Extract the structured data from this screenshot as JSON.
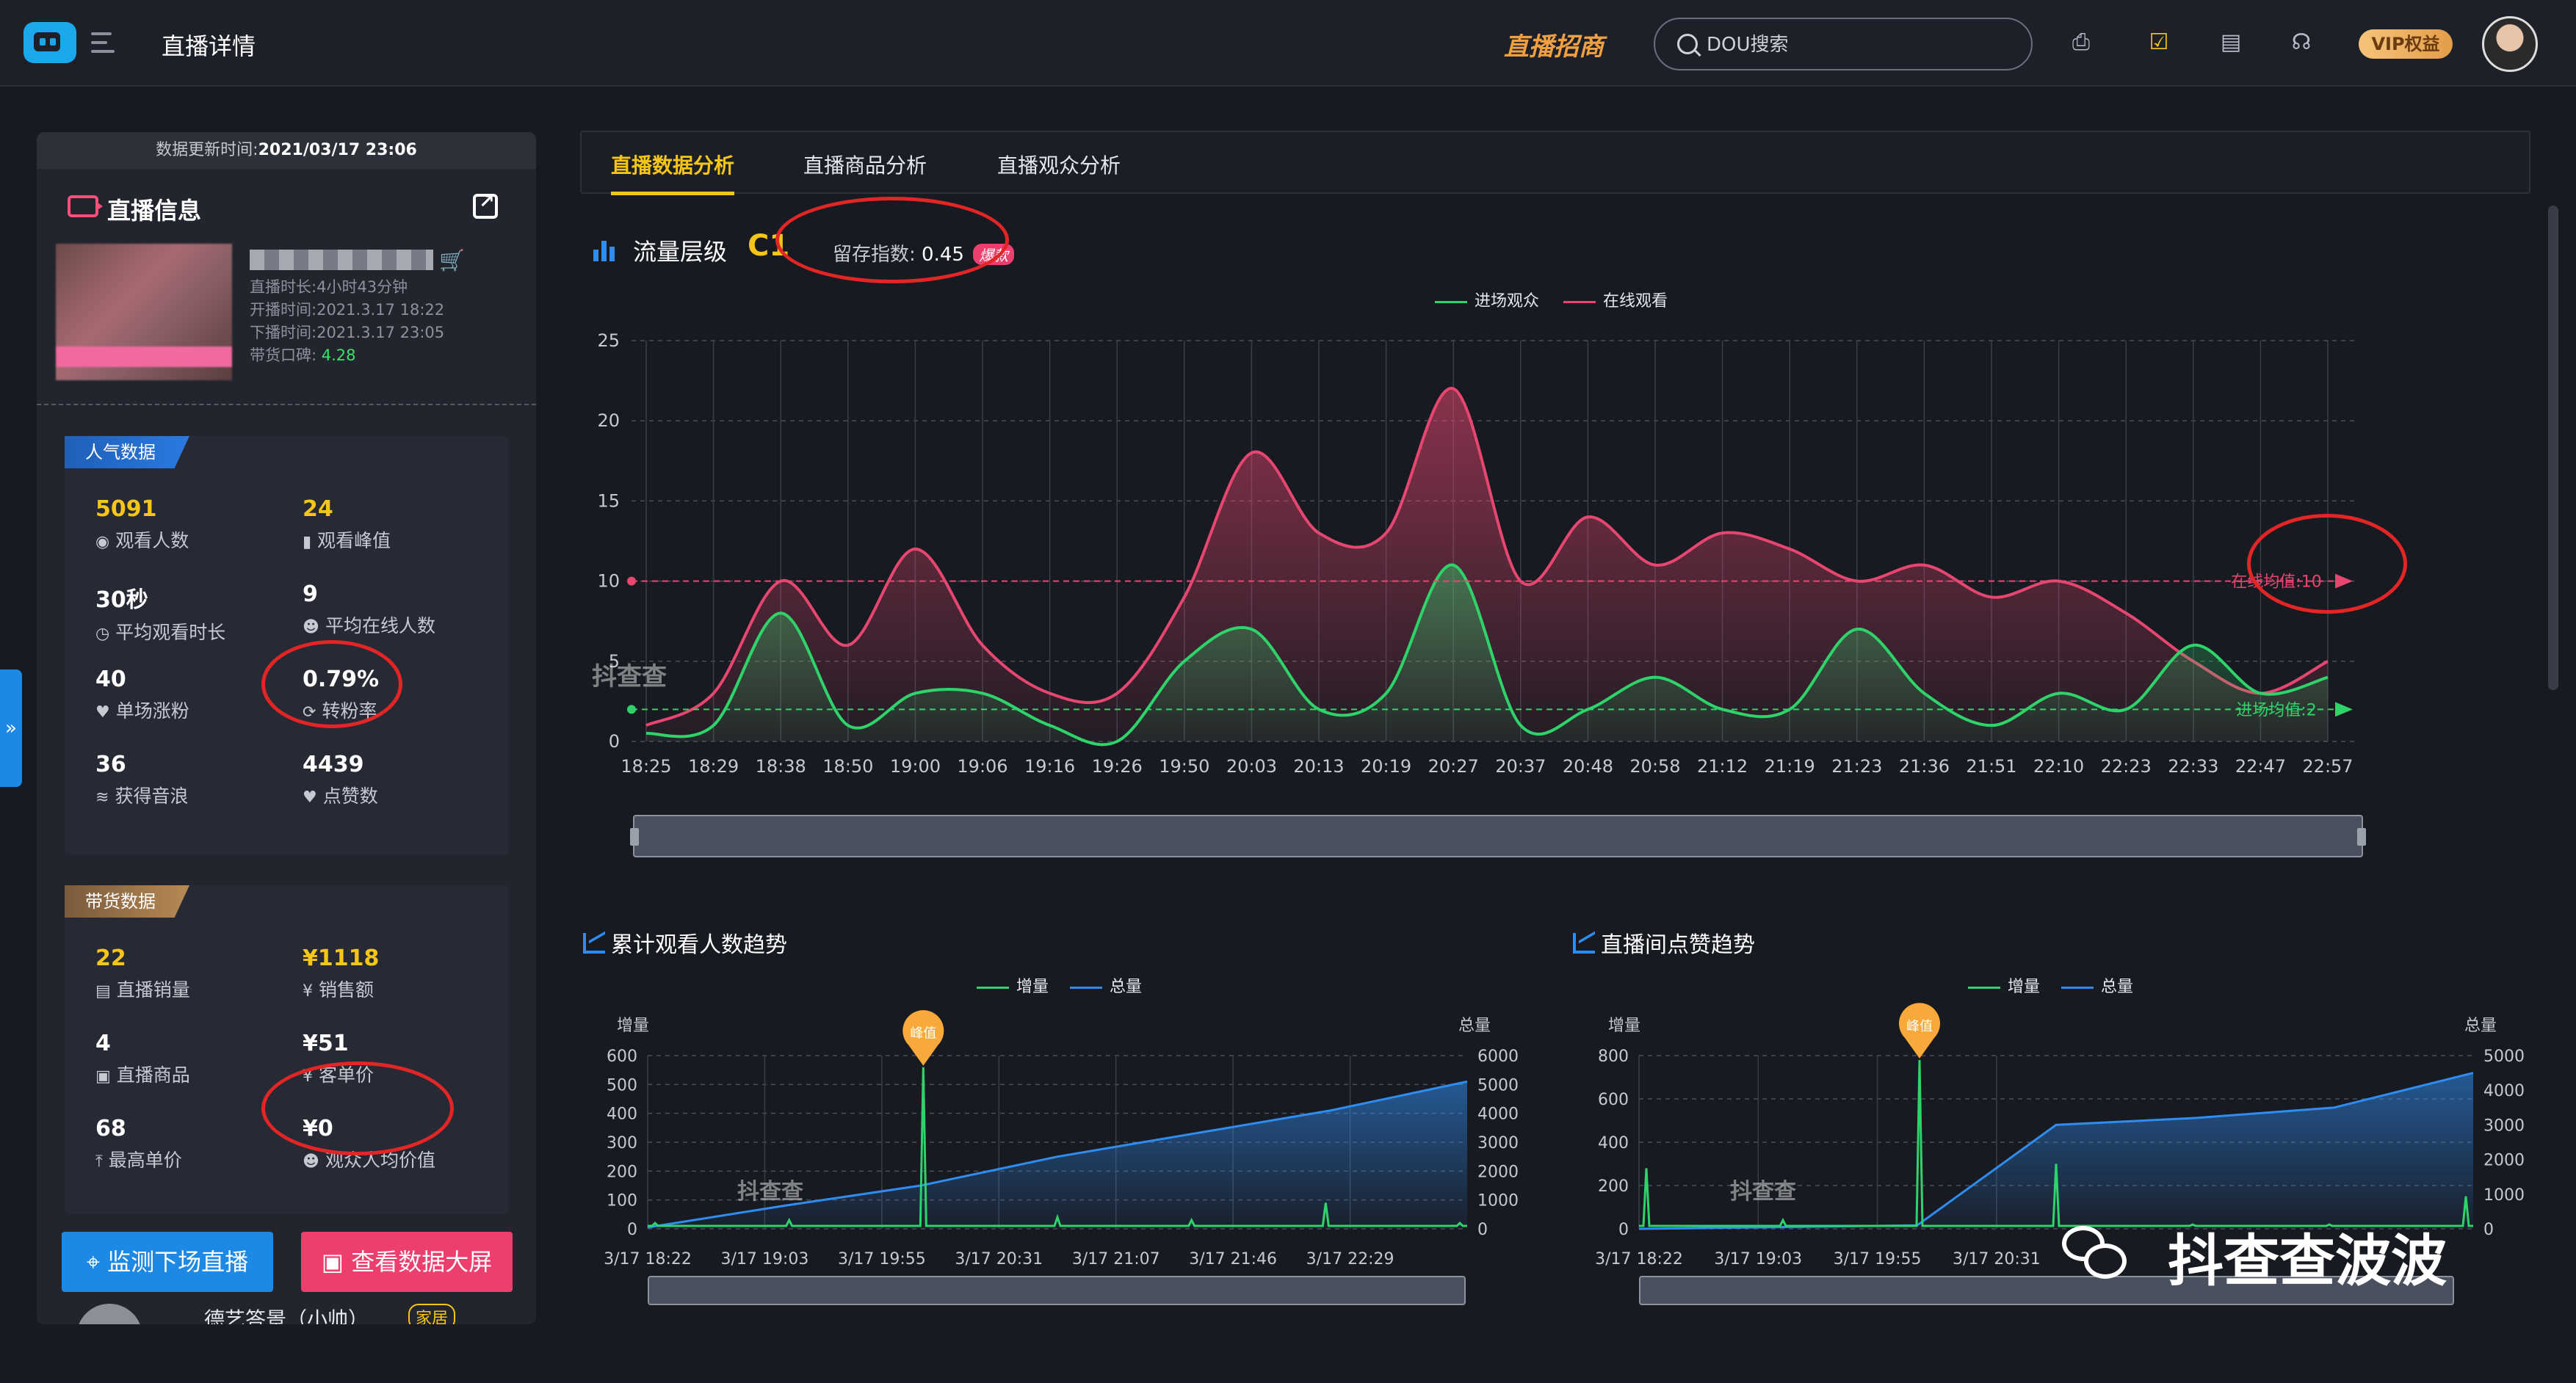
{
  "header": {
    "page_title": "直播详情",
    "biz_link": "直播招商",
    "search_placeholder": "DOU搜索",
    "vip_label": "VIP权益"
  },
  "left_panel": {
    "update_label": "数据更新时间:",
    "update_time": "2021/03/17 23:06",
    "section_title": "直播信息",
    "live_meta": [
      {
        "label": "直播时长:",
        "value": "4小时43分钟"
      },
      {
        "label": "开播时间:",
        "value": "2021.3.17 18:22"
      },
      {
        "label": "下播时间:",
        "value": "2021.3.17 23:05"
      },
      {
        "label": "带货口碑:",
        "value": "4.28"
      }
    ],
    "popularity": {
      "tag": "人气数据",
      "stats": [
        {
          "value": "5091",
          "label": "观看人数",
          "icon": "eye-icon",
          "glyph": "◉"
        },
        {
          "value": "24",
          "label": "观看峰值",
          "icon": "bar-chart-icon",
          "glyph": "▮"
        },
        {
          "value": "30秒",
          "label": "平均观看时长",
          "icon": "clock-icon",
          "glyph": "◷"
        },
        {
          "value": "9",
          "label": "平均在线人数",
          "icon": "user-icon",
          "glyph": "☻"
        },
        {
          "value": "40",
          "label": "单场涨粉",
          "icon": "heart-plus-icon",
          "glyph": "♥"
        },
        {
          "value": "0.79%",
          "label": "转粉率",
          "icon": "convert-icon",
          "glyph": "⟳"
        },
        {
          "value": "36",
          "label": "获得音浪",
          "icon": "wave-icon",
          "glyph": "≋"
        },
        {
          "value": "4439",
          "label": "点赞数",
          "icon": "heart-icon",
          "glyph": "♥"
        }
      ]
    },
    "sales": {
      "tag": "带货数据",
      "stats": [
        {
          "value": "22",
          "label": "直播销量",
          "icon": "copy-icon",
          "glyph": "▤"
        },
        {
          "value": "¥1118",
          "label": "销售额",
          "icon": "yen-icon",
          "glyph": "¥"
        },
        {
          "value": "4",
          "label": "直播商品",
          "icon": "box-icon",
          "glyph": "▣"
        },
        {
          "value": "¥51",
          "label": "客单价",
          "icon": "yen-icon",
          "glyph": "¥"
        },
        {
          "value": "68",
          "label": "最高单价",
          "icon": "arrow-up-icon",
          "glyph": "⤒"
        },
        {
          "value": "¥0",
          "label": "观众人均价值",
          "icon": "user-icon",
          "glyph": "☻"
        }
      ]
    },
    "buttons": {
      "monitor": "监测下场直播",
      "screen": "查看数据大屏"
    },
    "streamer": {
      "name": "德艺答景（小帅）",
      "badge": "家居"
    }
  },
  "tabs": [
    "直播数据分析",
    "直播商品分析",
    "直播观众分析"
  ],
  "traffic": {
    "title": "流量层级",
    "level": "C1",
    "retain_label": "留存指数:",
    "retain_value": "0.45",
    "retain_tag": "爆款",
    "watermark": "抖查查"
  },
  "colors": {
    "green": "#2ed46a",
    "pink": "#e6466f",
    "blue": "#2f8df2",
    "accent": "#f5c518"
  },
  "chart_data": [
    {
      "type": "area",
      "legend": [
        "进场观众",
        "在线观看"
      ],
      "ylim": [
        0,
        25
      ],
      "yticks": [
        0,
        5,
        10,
        15,
        20,
        25
      ],
      "x": [
        "18:25",
        "18:29",
        "18:38",
        "18:50",
        "19:00",
        "19:06",
        "19:16",
        "19:26",
        "19:50",
        "20:03",
        "20:13",
        "20:19",
        "20:27",
        "20:37",
        "20:48",
        "20:58",
        "21:12",
        "21:19",
        "21:23",
        "21:36",
        "21:51",
        "22:10",
        "22:23",
        "22:33",
        "22:47",
        "22:57"
      ],
      "series": [
        {
          "name": "进场观众",
          "values": [
            0.5,
            1,
            8,
            1,
            3,
            3,
            1,
            0,
            5,
            7,
            2,
            3,
            11,
            1,
            2,
            4,
            2,
            2,
            7,
            3,
            1,
            3,
            2,
            6,
            3,
            4
          ]
        },
        {
          "name": "在线观看",
          "values": [
            1,
            3,
            10,
            6,
            12,
            6,
            3,
            3,
            9,
            18,
            13,
            13,
            22,
            10,
            14,
            11,
            13,
            12,
            10,
            11,
            9,
            10,
            8,
            5,
            3,
            5
          ]
        }
      ],
      "mark_lines": [
        {
          "label": "在线均值:10",
          "value": 10
        },
        {
          "label": "进场均值:2",
          "value": 2
        }
      ]
    },
    {
      "type": "line",
      "title": "累计观看人数趋势",
      "legend": [
        "增量",
        "总量"
      ],
      "ylabel": "增量",
      "y2label": "总量",
      "ylim": [
        0,
        600
      ],
      "y2lim": [
        0,
        6000
      ],
      "yticks": [
        0,
        100,
        200,
        300,
        400,
        500,
        600
      ],
      "y2ticks": [
        0,
        1000,
        2000,
        3000,
        4000,
        5000,
        6000
      ],
      "x": [
        "3/17 18:22",
        "3/17 19:03",
        "3/17 19:55",
        "3/17 20:31",
        "3/17 21:07",
        "3/17 21:46",
        "3/17 22:29"
      ],
      "peak_label": "峰值",
      "series": [
        {
          "name": "增量",
          "values": [
            20,
            30,
            560,
            40,
            30,
            90,
            20
          ]
        },
        {
          "name": "总量",
          "values": [
            50,
            800,
            1500,
            2500,
            3300,
            4100,
            5100
          ]
        }
      ]
    },
    {
      "type": "line",
      "title": "直播间点赞趋势",
      "legend": [
        "增量",
        "总量"
      ],
      "ylabel": "增量",
      "y2label": "总量",
      "ylim": [
        0,
        800
      ],
      "y2lim": [
        0,
        5000
      ],
      "yticks": [
        0,
        200,
        400,
        600,
        800
      ],
      "y2ticks": [
        0,
        1000,
        2000,
        3000,
        4000,
        5000
      ],
      "x": [
        "3/17 18:22",
        "3/17 19:03",
        "3/17 19:55",
        "3/17 20:31"
      ],
      "peak_label": "峰值",
      "series": [
        {
          "name": "增量",
          "values": [
            280,
            40,
            780,
            300,
            20,
            20,
            150
          ]
        },
        {
          "name": "总量",
          "values": [
            0,
            50,
            100,
            3000,
            3200,
            3500,
            4500
          ]
        }
      ]
    }
  ],
  "wechat": {
    "name": "抖查查波波"
  }
}
